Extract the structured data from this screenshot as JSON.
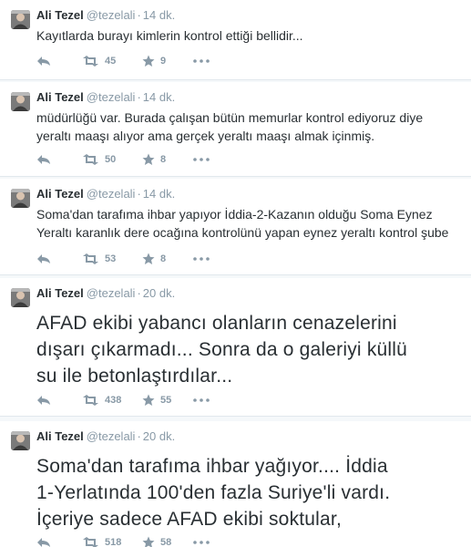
{
  "tweets": [
    {
      "name": "Ali Tezel",
      "handle": "@tezelali",
      "time": "14 dk.",
      "text": "Kayıtlarda burayı kimlerin kontrol ettiği bellidir...",
      "retweets": "45",
      "favorites": "9"
    },
    {
      "name": "Ali Tezel",
      "handle": "@tezelali",
      "time": "14 dk.",
      "text": "müdürlüğü var. Burada çalışan bütün memurlar kontrol ediyoruz diye\nyeraltı maaşı alıyor ama gerçek yeraltı maaşı almak içinmiş.",
      "retweets": "50",
      "favorites": "8"
    },
    {
      "name": "Ali Tezel",
      "handle": "@tezelali",
      "time": "14 dk.",
      "text": "Soma'dan tarafıma ihbar yapıyor İddia-2-Kazanın olduğu Soma Eynez\nYeraltı karanlık dere ocağına kontrolünü yapan eynez yeraltı kontrol şube",
      "retweets": "53",
      "favorites": "8"
    },
    {
      "name": "Ali Tezel",
      "handle": "@tezelali",
      "time": "20 dk.",
      "text": "AFAD ekibi yabancı olanların cenazelerini\ndışarı çıkarmadı... Sonra da o galeriyi küllü\nsu ile betonlaştırdılar...",
      "retweets": "438",
      "favorites": "55"
    },
    {
      "name": "Ali Tezel",
      "handle": "@tezelali",
      "time": "20 dk.",
      "text": "Soma'dan tarafıma ihbar yağıyor....  İddia\n1-Yerlatında 100'den fazla Suriye'li vardı.\nİçeriye sadece AFAD ekibi soktular,",
      "retweets": "518",
      "favorites": "58"
    }
  ]
}
